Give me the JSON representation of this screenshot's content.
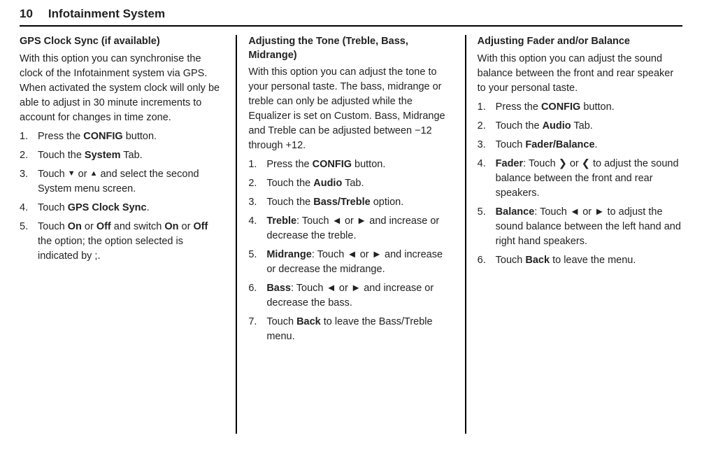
{
  "header": {
    "pageNumber": "10",
    "title": "Infotainment System"
  },
  "col1": {
    "heading": "GPS Clock Sync (if available)",
    "intro": "With this option you can synchronise the clock of the Infotainment system via GPS.\nWhen activated the system clock will only be able to adjust in 30 minute increments to account for changes in time zone.",
    "steps": [
      {
        "pre": "Press the ",
        "b1": "CONFIG",
        "post": " button."
      },
      {
        "pre": "Touch the ",
        "b1": "System",
        "post": " Tab."
      },
      {
        "pre": "Touch ",
        "sym1": "▼",
        "mid": " or ",
        "sym2": "▲",
        "post": " and select the second System menu screen."
      },
      {
        "pre": "Touch ",
        "b1": "GPS Clock Sync",
        "post": "."
      },
      {
        "pre": "Touch ",
        "b1": "On",
        "mid1": " or ",
        "b2": "Off",
        "mid2": " and switch ",
        "b3": "On",
        "mid3": " or ",
        "b4": "Off",
        "post": " the option; the option selected is indicated by ;."
      }
    ]
  },
  "col2": {
    "heading": "Adjusting the Tone (Treble, Bass, Midrange)",
    "intro": "With this option you can adjust the tone to your personal taste. The bass, midrange or treble can only be adjusted while the Equalizer is set on Custom. Bass, Midrange and Treble can be adjusted between −12 through +12.",
    "steps": [
      {
        "pre": "Press the ",
        "b1": "CONFIG",
        "post": " button."
      },
      {
        "pre": "Touch the ",
        "b1": "Audio",
        "post": " Tab."
      },
      {
        "pre": "Touch the ",
        "b1": "Bass/Treble",
        "post": " option."
      },
      {
        "b1": "Treble",
        "mid1": ": Touch ",
        "sym1": "◄",
        "mid2": " or ",
        "sym2": "►",
        "post": " and increase or decrease the treble."
      },
      {
        "b1": "Midrange",
        "mid1": ": Touch ",
        "sym1": "◄",
        "mid2": " or ",
        "sym2": "►",
        "post": " and increase or decrease the midrange."
      },
      {
        "b1": "Bass",
        "mid1": ": Touch ",
        "sym1": "◄",
        "mid2": " or ",
        "sym2": "►",
        "post": " and increase or decrease the bass."
      },
      {
        "pre": "Touch ",
        "b1": "Back",
        "post": " to leave the Bass/Treble menu."
      }
    ]
  },
  "col3": {
    "heading": "Adjusting Fader and/or Balance",
    "intro": "With this option you can adjust the sound balance between the front and rear speaker to your personal taste.",
    "steps": [
      {
        "pre": "Press the ",
        "b1": "CONFIG",
        "post": " button."
      },
      {
        "pre": "Touch the ",
        "b1": "Audio",
        "post": " Tab."
      },
      {
        "pre": "Touch ",
        "b1": "Fader/Balance",
        "post": "."
      },
      {
        "b1": "Fader",
        "mid1": ": Touch ",
        "sym1": "❯",
        "mid2": " or ",
        "sym2": "❮",
        "post": " to adjust the sound balance between the front and rear speakers."
      },
      {
        "b1": "Balance",
        "mid1": ": Touch ",
        "sym1": "◄",
        "mid2": " or ",
        "sym2": "►",
        "post": " to adjust the sound balance between the left hand and right hand speakers."
      },
      {
        "pre": "Touch ",
        "b1": "Back",
        "post": " to leave the menu."
      }
    ]
  }
}
